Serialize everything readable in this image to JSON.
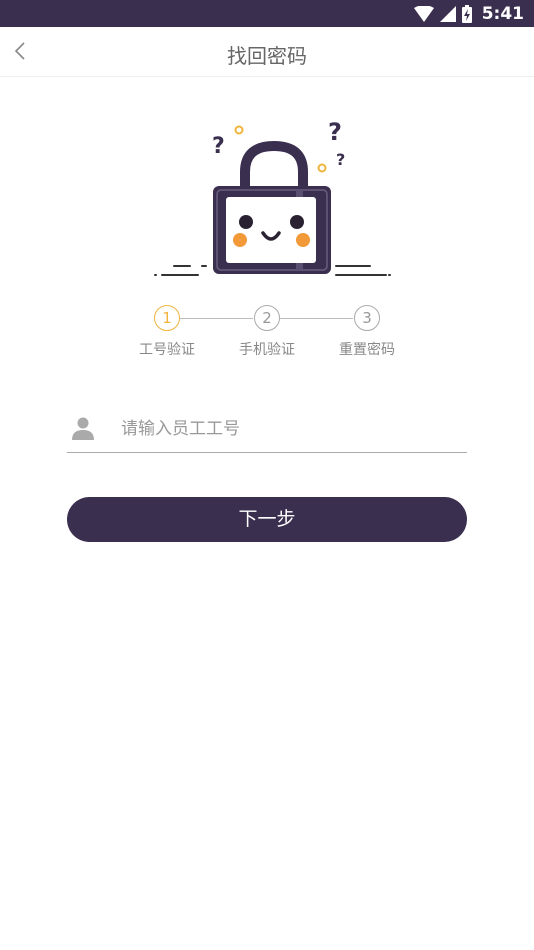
{
  "status_bar": {
    "time": "5:41"
  },
  "header": {
    "title": "找回密码"
  },
  "steps": [
    {
      "number": "1",
      "label": "工号验证",
      "active": true
    },
    {
      "number": "2",
      "label": "手机验证",
      "active": false
    },
    {
      "number": "3",
      "label": "重置密码",
      "active": false
    }
  ],
  "form": {
    "employee_id_placeholder": "请输入员工工号",
    "employee_id_value": ""
  },
  "actions": {
    "next_label": "下一步"
  },
  "colors": {
    "primary": "#3b2f4f",
    "step_active": "#f0b53c",
    "cheek": "#f29a3a",
    "muted_text": "#999999"
  }
}
